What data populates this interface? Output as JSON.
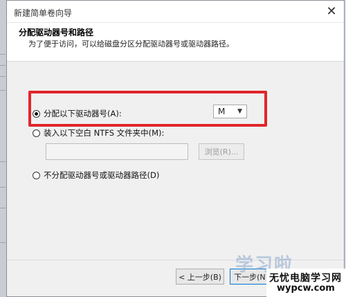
{
  "window": {
    "title": "新建简单卷向导"
  },
  "header": {
    "title": "分配驱动器号和路径",
    "subtitle": "为了便于访问，可以给磁盘分区分配驱动器号或驱动器路径。"
  },
  "options": {
    "assign_letter": "分配以下驱动器号(A):",
    "mount_folder": "装入以下空白 NTFS 文件夹中(M):",
    "no_assign": "不分配驱动器号或驱动器路径(D)"
  },
  "drive_letter": {
    "value": "M"
  },
  "browse_label": "浏览(R)...",
  "buttons": {
    "back": "< 上一步(B)",
    "next": "下一步(N)"
  },
  "watermark": {
    "big": "学习啦",
    "line1": "无忧电脑学习网",
    "line2": "wypcw.com"
  }
}
